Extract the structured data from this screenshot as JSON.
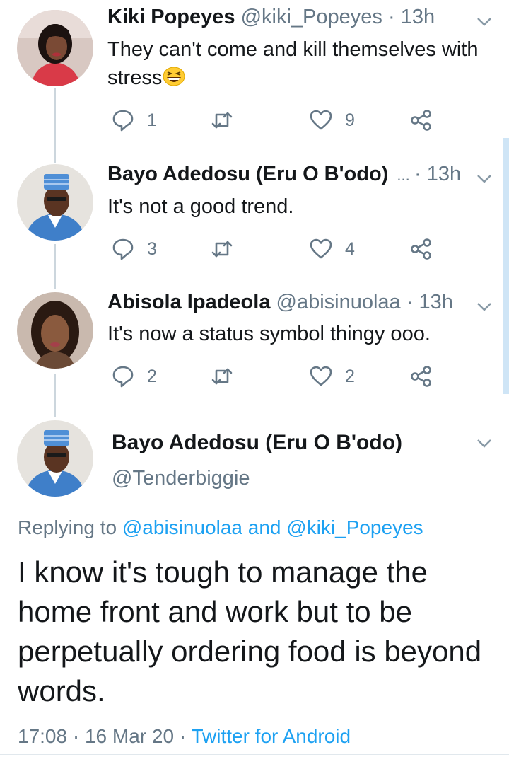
{
  "replies": [
    {
      "name": "Kiki Popeyes",
      "handle": "@kiki_Popeyes",
      "separator": "·",
      "time": "13h",
      "text": "They can't come and kill themselves with stress",
      "emoji": "grinning-squinting-face",
      "reply_count": "1",
      "like_count": "9"
    },
    {
      "name": "Bayo Adedosu (Eru O B'odo)",
      "ellipsis": "...",
      "separator": "·",
      "time": "13h",
      "text": "It's not a good trend.",
      "reply_count": "3",
      "like_count": "4"
    },
    {
      "name": "Abisola Ipadeola",
      "handle": "@abisinuolaa",
      "separator": "·",
      "time": "13h",
      "text": "It's now a status symbol thingy ooo.",
      "reply_count": "2",
      "like_count": "2"
    }
  ],
  "main_tweet": {
    "name": "Bayo Adedosu (Eru O B'odo)",
    "handle": "@Tenderbiggie",
    "replying_prefix": "Replying to",
    "replying_user1": "@abisinuolaa",
    "replying_and": "and",
    "replying_user2": "@kiki_Popeyes",
    "text": "I know it's tough to manage the home front and work but to be perpetually ordering food is beyond words.",
    "time": "17:08",
    "separator": "·",
    "date": "16 Mar 20",
    "source": "Twitter for Android"
  },
  "colors": {
    "link": "#1da1f2",
    "secondary_text": "#657786",
    "thread_line": "#ccd6dd"
  },
  "icons": [
    "reply-icon",
    "retweet-icon",
    "like-icon",
    "share-icon",
    "chevron-down-icon"
  ]
}
